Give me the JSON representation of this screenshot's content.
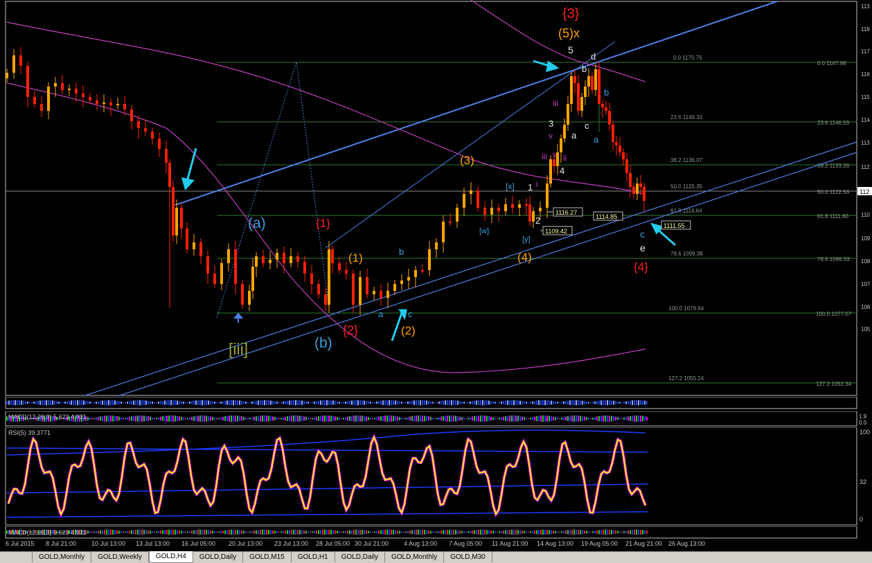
{
  "colors": {
    "background": "#000000",
    "candle": "#ffa500",
    "candle_bear": "#ff2000",
    "channel": "#4f7fe6",
    "ma": "#c040c0",
    "fib": "#2e7d32",
    "rsi": "#ffff00",
    "rsi_glow": "#ff00ff",
    "cyan": "#22ccee",
    "orange_label": "#ffa000",
    "red_label": "#ff2020"
  },
  "wave_labels": [
    {
      "text": "{3}",
      "color": "red"
    },
    {
      "text": "(5)x",
      "color": "orange"
    },
    {
      "text": "5",
      "color": "white"
    },
    {
      "text": "d",
      "color": "white"
    },
    {
      "text": "b",
      "color": "white"
    },
    {
      "text": "b",
      "color": "blue"
    },
    {
      "text": "iii",
      "color": "magenta"
    },
    {
      "text": "3",
      "color": "white"
    },
    {
      "text": "v",
      "color": "magenta"
    },
    {
      "text": "c",
      "color": "white"
    },
    {
      "text": "a",
      "color": "white"
    },
    {
      "text": "a",
      "color": "blue"
    },
    {
      "text": "(3)",
      "color": "orange"
    },
    {
      "text": "iii",
      "color": "magenta"
    },
    {
      "text": "v",
      "color": "magenta"
    },
    {
      "text": "ii",
      "color": "magenta"
    },
    {
      "text": "4",
      "color": "white"
    },
    {
      "text": "[x]",
      "color": "blue"
    },
    {
      "text": "i",
      "color": "magenta"
    },
    {
      "text": "1",
      "color": "white"
    },
    {
      "text": "2",
      "color": "white"
    },
    {
      "text": "[w]",
      "color": "blue"
    },
    {
      "text": "[y]",
      "color": "blue"
    },
    {
      "text": "(4)",
      "color": "orange"
    },
    {
      "text": "(a)",
      "color": "blue"
    },
    {
      "text": "{1}",
      "color": "red"
    },
    {
      "text": "(1)",
      "color": "orange"
    },
    {
      "text": "b",
      "color": "blue"
    },
    {
      "text": "a",
      "color": "blue"
    },
    {
      "text": "c",
      "color": "blue"
    },
    {
      "text": "(2)",
      "color": "orange"
    },
    {
      "text": "{2}",
      "color": "red"
    },
    {
      "text": "(b)",
      "color": "blue"
    },
    {
      "text": "[iii]",
      "color": "olive"
    },
    {
      "text": "c",
      "color": "blue"
    },
    {
      "text": "e",
      "color": "white"
    },
    {
      "text": "{4}",
      "color": "red"
    }
  ],
  "fib_left": [
    {
      "ratio": "0.0",
      "price": "1170.76"
    },
    {
      "ratio": "23.6",
      "price": "1149.33"
    },
    {
      "ratio": "38.2",
      "price": "1136.07"
    },
    {
      "ratio": "50.0",
      "price": "1125.35"
    },
    {
      "ratio": "61.8",
      "price": "1114.64"
    },
    {
      "ratio": "78.6",
      "price": "1099.38"
    },
    {
      "ratio": "100.0",
      "price": "1079.94"
    },
    {
      "ratio": "127.2",
      "price": "1055.24"
    }
  ],
  "fib_right": [
    {
      "ratio": "0.0",
      "price": "1167.98"
    },
    {
      "ratio": "23.6",
      "price": "1146.53"
    },
    {
      "ratio": "38.2",
      "price": "1133.26"
    },
    {
      "ratio": "50.0",
      "price": "1122.53"
    },
    {
      "ratio": "61.8",
      "price": "1111.80"
    },
    {
      "ratio": "78.6",
      "price": "1096.53"
    },
    {
      "ratio": "100.0",
      "price": "1077.07"
    },
    {
      "ratio": "127.2",
      "price": "1052.34"
    }
  ],
  "price_boxes": [
    "1116.27",
    "1109.42",
    "1114.85",
    "1111.55"
  ],
  "price_axis": [
    "113",
    "118",
    "117",
    "116",
    "115",
    "114",
    "113",
    "112",
    "111",
    "110",
    "109",
    "108",
    "107",
    "106",
    "105"
  ],
  "price_axis_current": "112",
  "indicators": {
    "macd1": "MACD(12,26,9) 5.623 4.931",
    "rsi": "RSI(5) 39.3771",
    "macd2": "MACD(12,26,9) 5.623 4.931"
  },
  "rsi_axis": [
    "100",
    "32",
    "0"
  ],
  "macd_axis": [
    "1.9",
    "0.0"
  ],
  "time_labels": [
    "6 Jul 2015",
    "8 Jul 21:00",
    "10 Jul 13:00",
    "13 Jul 13:00",
    "16 Jul 05:00",
    "20 Jul 13:00",
    "23 Jul 13:00",
    "28 Jul 05:00",
    "30 Jul 21:00",
    "4 Aug 13:00",
    "7 Aug 05:00",
    "11 Aug 21:00",
    "14 Aug 13:00",
    "19 Aug 05:00",
    "21 Aug 21:00",
    "26 Aug 13:00"
  ],
  "tabs": [
    "GOLD,Monthly",
    "GOLD,Weekly",
    "GOLD,H4",
    "GOLD,Daily",
    "GOLD,M15",
    "GOLD,H1",
    "GOLD,Daily",
    "GOLD,Monthly",
    "GOLD,M30"
  ],
  "active_tab": "GOLD,H4"
}
